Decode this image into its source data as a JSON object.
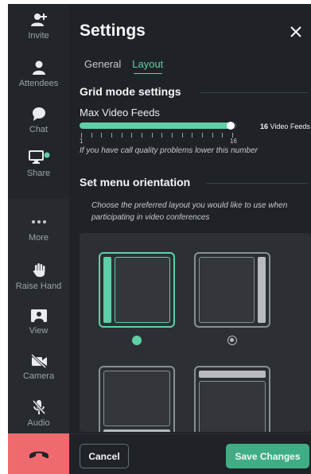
{
  "sidebar": {
    "items": [
      {
        "label": "Invite",
        "icon": "add-person-icon"
      },
      {
        "label": "Attendees",
        "icon": "person-icon"
      },
      {
        "label": "Chat",
        "icon": "chat-bubble-icon"
      },
      {
        "label": "Share",
        "icon": "monitor-share-icon"
      },
      {
        "label": "More",
        "icon": "more-dots-icon"
      },
      {
        "label": "Raise Hand",
        "icon": "raise-hand-icon"
      },
      {
        "label": "View",
        "icon": "view-layout-icon"
      },
      {
        "label": "Camera",
        "icon": "camera-off-icon"
      },
      {
        "label": "Audio",
        "icon": "mic-off-icon"
      }
    ],
    "hangup_icon": "hang-up-phone-icon"
  },
  "settings": {
    "title": "Settings",
    "tabs": [
      {
        "label": "General",
        "active": false
      },
      {
        "label": "Layout",
        "active": true
      }
    ],
    "grid_section": {
      "heading": "Grid mode settings",
      "slider_label": "Max Video Feeds",
      "slider_min": "1",
      "slider_max": "16",
      "slider_value": 16,
      "value_number": "16",
      "value_unit": " Video Feeds",
      "hint": "If you have call quality problems lower this number"
    },
    "orientation_section": {
      "heading": "Set menu orientation",
      "description": "Choose the preferred layout you would like to use when participating in video conferences",
      "options": [
        "left-sidebar",
        "right-sidebar",
        "bottom-bar",
        "top-bar"
      ],
      "selected": "left-sidebar"
    }
  },
  "footer": {
    "cancel_label": "Cancel",
    "save_label": "Save Changes"
  },
  "colors": {
    "accent": "#5fcfa6",
    "save_button": "#3fae85",
    "hangup": "#ef6a6e",
    "panel_bg": "#1f2327"
  }
}
